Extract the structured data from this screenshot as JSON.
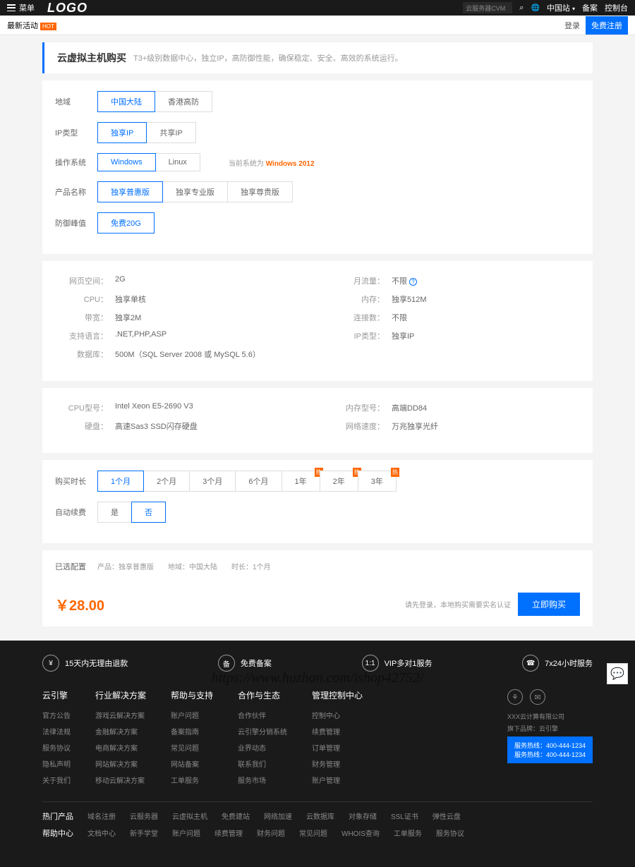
{
  "topbar": {
    "menu": "菜单",
    "logo": "LOGO",
    "search_placeholder": "云服务器CVM",
    "region": "中国站",
    "beian": "备案",
    "console": "控制台"
  },
  "subbar": {
    "latest": "最新活动",
    "hot_tag": "HOT",
    "login": "登录",
    "register": "免费注册"
  },
  "title": {
    "heading": "云虚拟主机购买",
    "desc": "T3+级别数据中心，独立IP，高防御性能，确保稳定、安全、高效的系统运行。"
  },
  "config": {
    "location_label": "地域",
    "location_opts": [
      "中国大陆",
      "香港高防"
    ],
    "ip_label": "IP类型",
    "ip_opts": [
      "独享IP",
      "共享IP"
    ],
    "os_label": "操作系统",
    "os_opts": [
      "Windows",
      "Linux"
    ],
    "os_note_pre": "当前系统为",
    "os_note_val": "Windows 2012",
    "product_label": "产品名称",
    "product_opts": [
      "独享普惠版",
      "独享专业版",
      "独享尊贵版"
    ],
    "defense_label": "防御峰值",
    "defense_opts": [
      "免费20G"
    ]
  },
  "specs": {
    "left": [
      {
        "k": "网页空间：",
        "v": "2G"
      },
      {
        "k": "CPU：",
        "v": "独享单核"
      },
      {
        "k": "带宽：",
        "v": "独享2M"
      },
      {
        "k": "支持语言：",
        "v": ".NET,PHP,ASP"
      },
      {
        "k": "数据库：",
        "v": "500M（SQL Server 2008 或 MySQL 5.6）"
      }
    ],
    "right": [
      {
        "k": "月流量：",
        "v": "不限",
        "help": true
      },
      {
        "k": "内存：",
        "v": "独享512M"
      },
      {
        "k": "连接数：",
        "v": "不限"
      },
      {
        "k": "IP类型：",
        "v": "独享IP"
      }
    ]
  },
  "hardware": {
    "left": [
      {
        "k": "CPU型号：",
        "v": "Intel Xeon E5-2690 V3"
      },
      {
        "k": "硬盘：",
        "v": "高速Sas3 SSD闪存硬盘"
      }
    ],
    "right": [
      {
        "k": "内存型号：",
        "v": "高端DD84"
      },
      {
        "k": "网络速度：",
        "v": "万兆独享光纤"
      }
    ]
  },
  "purchase": {
    "duration_label": "购买时长",
    "durations": [
      "1个月",
      "2个月",
      "3个月",
      "6个月",
      "1年",
      "2年",
      "3年"
    ],
    "renew_label": "自动续费",
    "renew_opts": [
      "是",
      "否"
    ],
    "selected_label": "已选配置",
    "summary": "产品：独享普惠版　　地域：中国大陆　　时长：1个月",
    "price": "￥28.00",
    "note": "请先登录，本地购买需要实名认证",
    "buy_btn": "立即购买"
  },
  "footer": {
    "badges": [
      "15天内无理由退款",
      "免费备案",
      "VIP多对1服务",
      "7x24小时服务"
    ],
    "badge_icons": [
      "¥",
      "备",
      "1:1",
      "☎"
    ],
    "cols": [
      {
        "title": "云引擎",
        "links": [
          "官方公告",
          "法律法规",
          "服务协议",
          "隐私声明",
          "关于我们"
        ]
      },
      {
        "title": "行业解决方案",
        "links": [
          "游戏云解决方案",
          "金融解决方案",
          "电商解决方案",
          "网站解决方案",
          "移动云解决方案"
        ]
      },
      {
        "title": "帮助与支持",
        "links": [
          "账户问题",
          "备案指南",
          "常见问题",
          "网站备案",
          "工单服务"
        ]
      },
      {
        "title": "合作与生态",
        "links": [
          "合作伙伴",
          "云引擎分销系统",
          "业界动态",
          "联系我们",
          "服务市场"
        ]
      },
      {
        "title": "管理控制中心",
        "links": [
          "控制中心",
          "续费管理",
          "订单管理",
          "财务管理",
          "账户管理"
        ]
      }
    ],
    "contact": {
      "company": "XXX云计算有限公司",
      "brand": "旗下品牌：云引擎",
      "hotline1": "服务热线：400-444-1234",
      "hotline2": "服务热线：400-444-1234"
    },
    "hotlinks": {
      "label1": "热门产品",
      "row1": [
        "域名注册",
        "云服务器",
        "云虚拟主机",
        "免费建站",
        "网络加速",
        "云数据库",
        "对象存储",
        "SSL证书",
        "弹性云盘"
      ],
      "label2": "帮助中心",
      "row2": [
        "文档中心",
        "新手学堂",
        "账户问题",
        "续费管理",
        "财务问题",
        "常见问题",
        "WHOIS查询",
        "工单服务",
        "服务协议"
      ]
    }
  },
  "watermark": "https://www.huzhan.com/ishop42752/"
}
